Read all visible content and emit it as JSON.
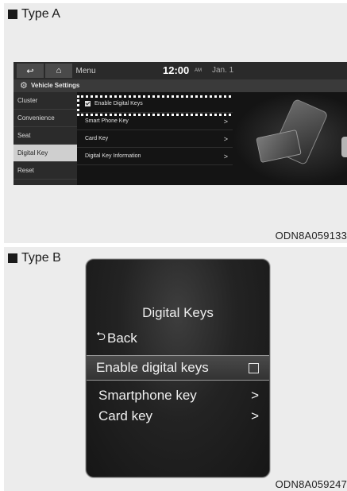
{
  "panel_a": {
    "label": "Type A",
    "caption": "ODN8A059133",
    "topbar": {
      "back_icon": "↩",
      "home_icon": "⌂",
      "menu_label": "Menu",
      "time": "12:00",
      "ampm": "AM",
      "date": "Jan. 1"
    },
    "section_title": "Vehicle Settings",
    "sidebar": [
      "Cluster",
      "Convenience",
      "Seat",
      "Digital Key",
      "Reset"
    ],
    "active_sidebar": "Digital Key",
    "rows": {
      "enable": "Enable Digital Keys",
      "smartphone": "Smart Phone Key",
      "card": "Card Key",
      "info": "Digital Key Information"
    },
    "enable_checked": true
  },
  "panel_b": {
    "label": "Type B",
    "caption": "ODN8A059247",
    "title": "Digital Keys",
    "back": "Back",
    "enable": "Enable digital keys",
    "enable_checked": false,
    "smartphone": "Smartphone key",
    "card": "Card key"
  },
  "colors": {
    "panel_bg": "#ececec",
    "screen_bg": "#0d0d0d",
    "sidebar_active": "#cfcfcf",
    "highlight_dash": "#ffffff"
  },
  "icons": {
    "back": "back-arrow-icon",
    "home": "home-icon",
    "gear": "gear-icon",
    "chevron": "chevron-right-icon",
    "checkbox": "checkbox-icon"
  }
}
